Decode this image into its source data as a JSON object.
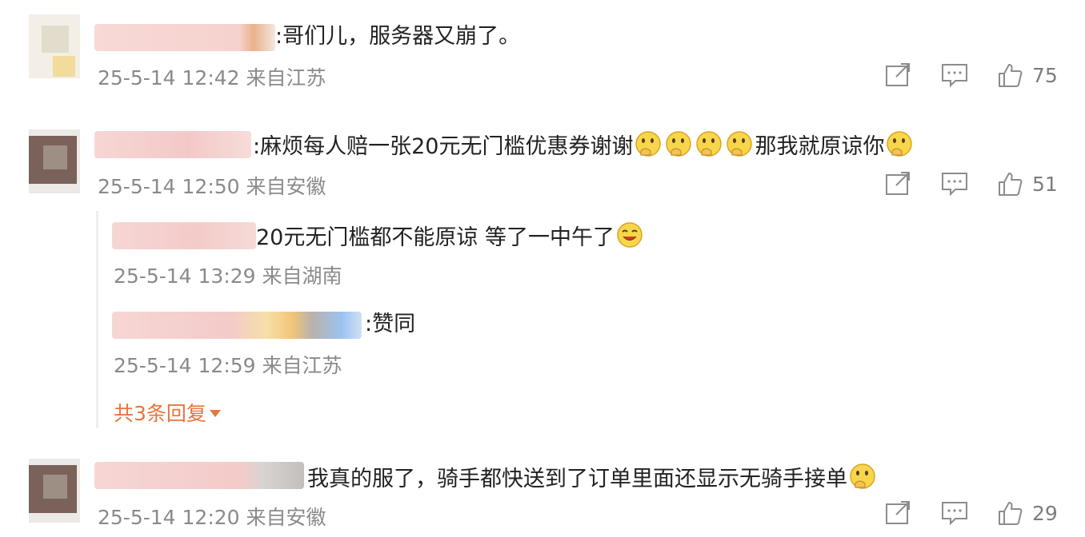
{
  "comments": [
    {
      "text": ":哥们儿，服务器又崩了。",
      "meta": "25-5-14 12:42 来自江苏",
      "likes": "75"
    },
    {
      "text_before": ":麻烦每人赔一张20元无门槛优惠券谢谢",
      "text_after": "那我就原谅你",
      "meta": "25-5-14 12:50 来自安徽",
      "likes": "51",
      "replies": [
        {
          "text": "20元无门槛都不能原谅 等了一中午了",
          "meta": "25-5-14 13:29 来自湖南"
        },
        {
          "text": ":赞同",
          "meta": "25-5-14 12:59 来自江苏"
        }
      ],
      "more_replies": "共3条回复"
    },
    {
      "text": "我真的服了，骑手都快送到了订单里面还显示无骑手接单",
      "meta": "25-5-14 12:20 来自安徽",
      "likes": "29"
    }
  ],
  "icons": {
    "share": "share-icon",
    "comment": "comment-icon",
    "like": "thumbs-up-icon",
    "emoji": "thinking-emoji",
    "smile": "smile-emoji",
    "caret": "caret-down-icon"
  },
  "colors": {
    "accent": "#e8743b",
    "meta": "#8a8a8a",
    "text": "#222222"
  }
}
